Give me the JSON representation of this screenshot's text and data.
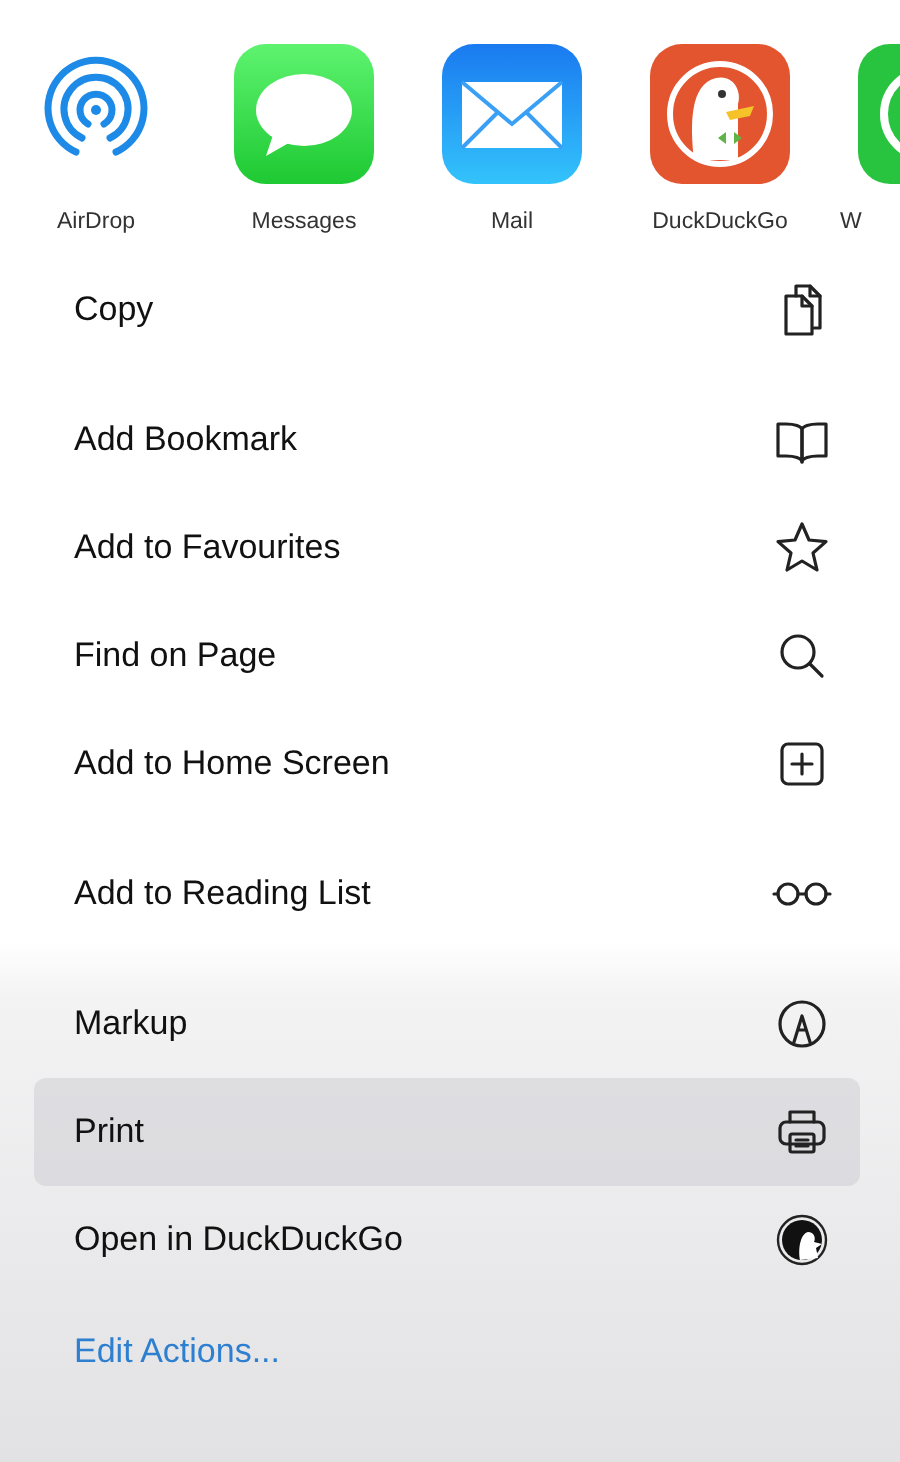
{
  "apps": [
    {
      "kind": "airdrop",
      "label": "AirDrop"
    },
    {
      "kind": "messages",
      "label": "Messages"
    },
    {
      "kind": "mail",
      "label": "Mail"
    },
    {
      "kind": "duckduckgo",
      "label": "DuckDuckGo"
    },
    {
      "kind": "whatsapp",
      "label": "W"
    }
  ],
  "action_groups": [
    [
      {
        "label": "Copy",
        "kind": "copy",
        "selected": false
      }
    ],
    [
      {
        "label": "Add Bookmark",
        "kind": "book",
        "selected": false
      },
      {
        "label": "Add to Favourites",
        "kind": "star",
        "selected": false
      },
      {
        "label": "Find on Page",
        "kind": "search",
        "selected": false
      },
      {
        "label": "Add to Home Screen",
        "kind": "plus-square",
        "selected": false
      }
    ],
    [
      {
        "label": "Add to Reading List",
        "kind": "glasses",
        "selected": false
      }
    ],
    [
      {
        "label": "Markup",
        "kind": "markup",
        "selected": false
      },
      {
        "label": "Print",
        "kind": "printer",
        "selected": true
      },
      {
        "label": "Open in DuckDuckGo",
        "kind": "duck",
        "selected": false
      }
    ]
  ],
  "edit_actions": "Edit Actions..."
}
